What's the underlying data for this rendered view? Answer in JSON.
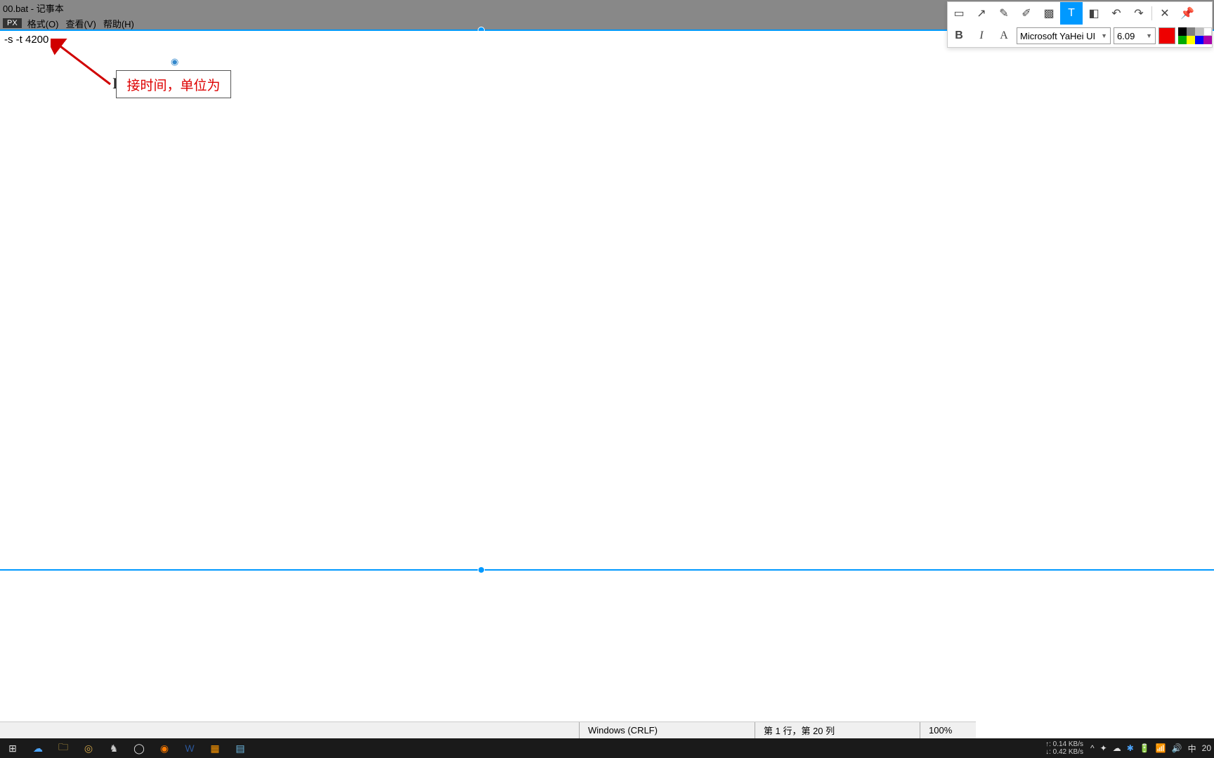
{
  "title": "00.bat - 记事本",
  "menubar": {
    "px_label": "PX",
    "items": [
      "格式(O)",
      "查看(V)",
      "帮助(H)"
    ]
  },
  "editor_text": "-s -t 4200",
  "annotation_text": "接时间，单位为",
  "toolbar": {
    "font": "Microsoft YaHei UI",
    "size": "6.09",
    "bold": "B",
    "italic": "I",
    "colors": {
      "main": "#e00000",
      "grid": [
        "#000000",
        "#808080",
        "#c0c0c0",
        "#ffffff",
        "#00a000",
        "#ffff00",
        "#0000ff",
        "#a000a0"
      ]
    }
  },
  "statusbar": {
    "encoding": "Windows (CRLF)",
    "position": "第 1 行，第 20 列",
    "zoom": "100%"
  },
  "taskbar": {
    "net_up": "↑: 0.14 KB/s",
    "net_down": "↓: 0.42 KB/s",
    "ime": "中",
    "time": "20"
  }
}
